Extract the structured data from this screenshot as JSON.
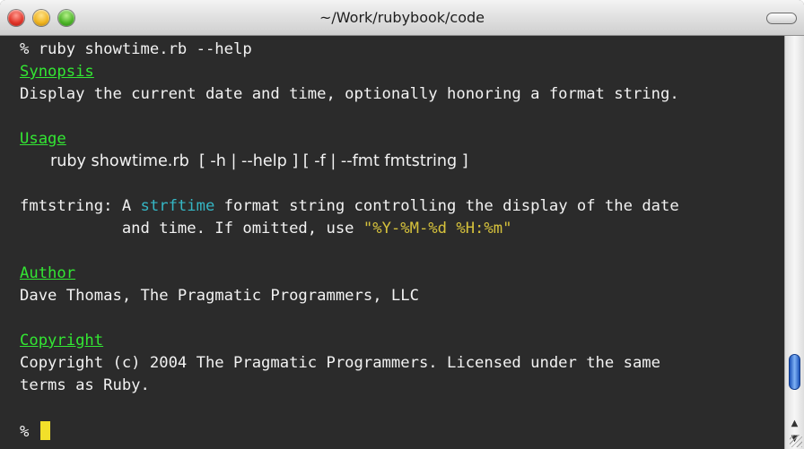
{
  "window": {
    "title": "~/Work/rubybook/code"
  },
  "terminal": {
    "command_line": "% ruby showtime.rb --help",
    "synopsis_heading": "Synopsis",
    "synopsis_text": "Display the current date and time, optionally honoring a format string.",
    "usage_heading": "Usage",
    "usage_text": "ruby showtime.rb  [ -h | --help ] [ -f | --fmt fmtstring ]",
    "fmt_prefix": "fmtstring: A ",
    "fmt_keyword": "strftime",
    "fmt_rest": " format string controlling the display of the date",
    "fmt_cont_prefix": "           and time. If omitted, use ",
    "fmt_default": "\"%Y-%M-%d %H:%m\"",
    "author_heading": "Author",
    "author_text": "Dave Thomas, The Pragmatic Programmers, LLC",
    "copyright_heading": "Copyright",
    "copyright_line1": "Copyright (c) 2004 The Pragmatic Programmers. Licensed under the same",
    "copyright_line2": "terms as Ruby.",
    "prompt": "%"
  },
  "colors": {
    "background": "#2b2b2b",
    "text": "#f2f2f2",
    "heading": "#33e633",
    "keyword": "#35b6c4",
    "string": "#d6c23c",
    "cursor": "#f2e02a"
  },
  "icons": [
    "close-button",
    "minimize-button",
    "zoom-button",
    "toolbar-toggle",
    "scroll-up-arrow-icon",
    "scroll-down-arrow-icon",
    "resize-grip-icon"
  ]
}
